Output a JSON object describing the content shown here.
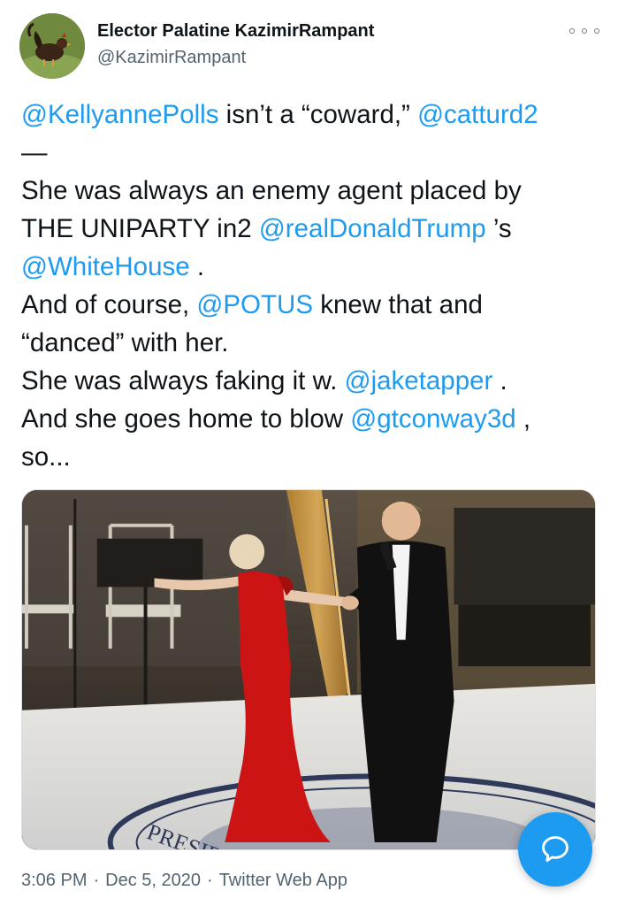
{
  "author": {
    "display_name": "Elector Palatine KazimirRampant",
    "handle": "@KazimirRampant"
  },
  "tweet": {
    "line1": {
      "m1": "@KellyannePolls",
      "t1": " isn’t a “coward,” ",
      "m2": "@catturd2"
    },
    "line2": "—",
    "line3": "She was always an enemy agent placed by",
    "line4": {
      "t1": "THE UNIPARTY in2 ",
      "m1": "@realDonaldTrump",
      "t2": " ’s"
    },
    "line5": {
      "m1": "@WhiteHouse",
      "t1": " ."
    },
    "line6": {
      "t1": "And of course, ",
      "m1": "@POTUS",
      "t2": " knew that and"
    },
    "line7": "“danced” with her.",
    "line8": {
      "t1": "She was always faking it w. ",
      "m1": "@jaketapper",
      "t2": " ."
    },
    "line9": {
      "t1": "And she goes home to blow ",
      "m1": "@gtconway3d",
      "t2": " ,"
    },
    "line10": "so..."
  },
  "media": {
    "floor_seal_text": "PRESIDENT"
  },
  "meta": {
    "time": "3:06 PM",
    "date": "Dec 5, 2020",
    "separator": "·",
    "source": "Twitter Web App"
  },
  "icons": {
    "more": "more-horizontal-icon",
    "compose": "chat-bubble-icon"
  },
  "colors": {
    "link": "#1d9bf0",
    "text": "#0f1419",
    "secondary": "#536471",
    "fab": "#1d9bf0"
  }
}
